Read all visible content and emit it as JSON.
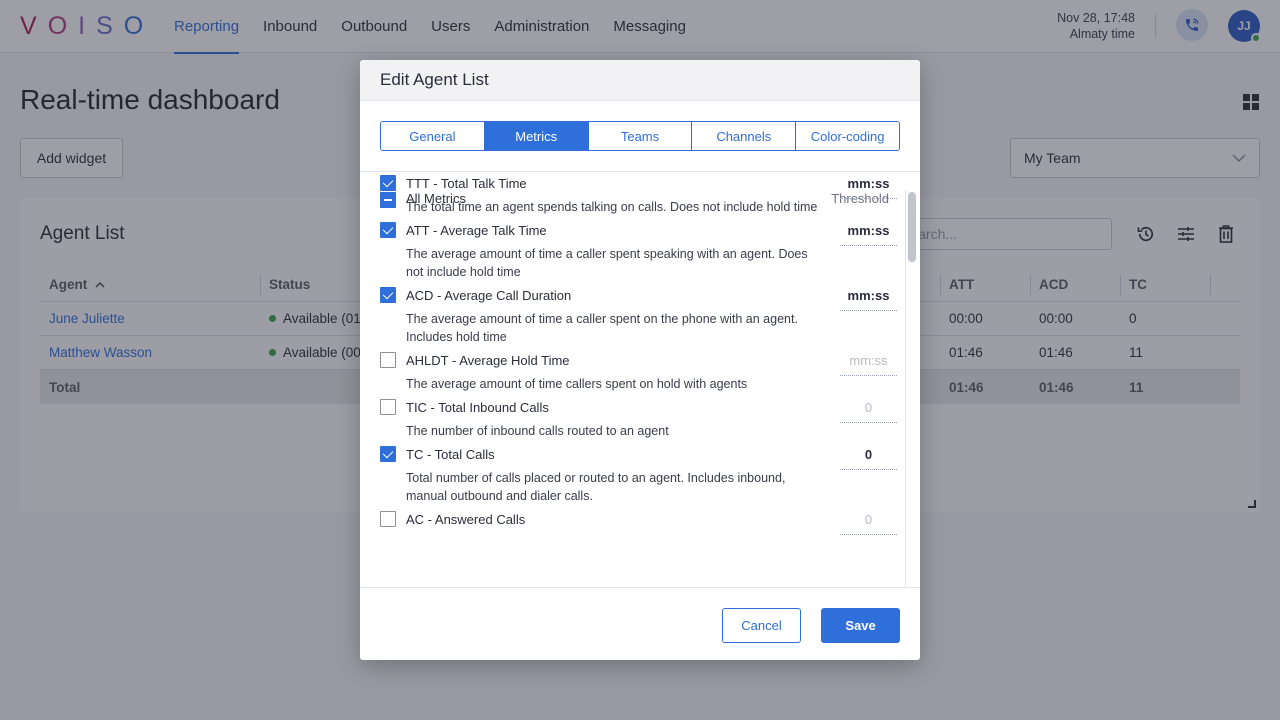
{
  "app": {
    "logo_letters": [
      {
        "char": "V",
        "color": "#b0215a"
      },
      {
        "char": "O",
        "color": "#b33a7e"
      },
      {
        "char": "I",
        "color": "#8d62b4"
      },
      {
        "char": "S",
        "color": "#6b6ec7"
      },
      {
        "char": "O",
        "color": "#2f6fd9"
      }
    ]
  },
  "nav": {
    "items": [
      {
        "label": "Reporting",
        "active": true
      },
      {
        "label": "Inbound"
      },
      {
        "label": "Outbound"
      },
      {
        "label": "Users"
      },
      {
        "label": "Administration"
      },
      {
        "label": "Messaging"
      }
    ],
    "datetime": "Nov 28, 17:48",
    "timezone": "Almaty time",
    "phone_icon": "phone-call-icon",
    "avatar_initials": "JJ",
    "avatar_status": "online"
  },
  "page": {
    "title": "Real-time dashboard",
    "add_widget_label": "Add widget",
    "team_select_value": "My Team",
    "layout_icon": "grid-icon"
  },
  "widget": {
    "title": "Agent List",
    "search_placeholder": "Search...",
    "icons": [
      "history-icon",
      "settings-sliders-icon",
      "trash-icon"
    ],
    "columns": {
      "agent": "Agent",
      "status": "Status",
      "att": "ATT",
      "acd": "ACD",
      "tc": "TC"
    },
    "rows": [
      {
        "agent": "June Juliette",
        "status": "Available (01",
        "att": "00:00",
        "acd": "00:00",
        "tc": "0"
      },
      {
        "agent": "Matthew Wasson",
        "status": "Available (00",
        "att": "01:46",
        "acd": "01:46",
        "tc": "11"
      }
    ],
    "total": {
      "label": "Total",
      "att": "01:46",
      "acd": "01:46",
      "tc": "11"
    }
  },
  "modal": {
    "title": "Edit Agent List",
    "tabs": [
      {
        "label": "General"
      },
      {
        "label": "Metrics",
        "active": true
      },
      {
        "label": "Teams"
      },
      {
        "label": "Channels"
      },
      {
        "label": "Color-coding"
      }
    ],
    "all_metrics_label": "All Metrics",
    "threshold_label": "Threshold",
    "metrics": [
      {
        "name": "TTT - Total Talk Time",
        "desc": "The total time an agent spends talking on calls. Does not include hold time",
        "checked": true,
        "threshold": "mm:ss"
      },
      {
        "name": "ATT - Average Talk Time",
        "desc": "The average amount of time a caller spent speaking with an agent. Does not include hold time",
        "checked": true,
        "threshold": "mm:ss"
      },
      {
        "name": "ACD - Average Call Duration",
        "desc": "The average amount of time a caller spent on the phone with an agent. Includes hold time",
        "checked": true,
        "threshold": "mm:ss"
      },
      {
        "name": "AHLDT - Average Hold Time",
        "desc": "The average amount of time callers spent on hold with agents",
        "checked": false,
        "threshold": "mm:ss"
      },
      {
        "name": "TIC - Total Inbound Calls",
        "desc": "The number of inbound calls routed to an agent",
        "checked": false,
        "threshold": "0"
      },
      {
        "name": "TC - Total Calls",
        "desc": "Total number of calls placed or routed to an agent. Includes inbound, manual outbound and dialer calls.",
        "checked": true,
        "threshold": "0"
      },
      {
        "name": "AC - Answered Calls",
        "desc": "",
        "checked": false,
        "threshold": "0"
      }
    ],
    "cancel_label": "Cancel",
    "save_label": "Save"
  }
}
